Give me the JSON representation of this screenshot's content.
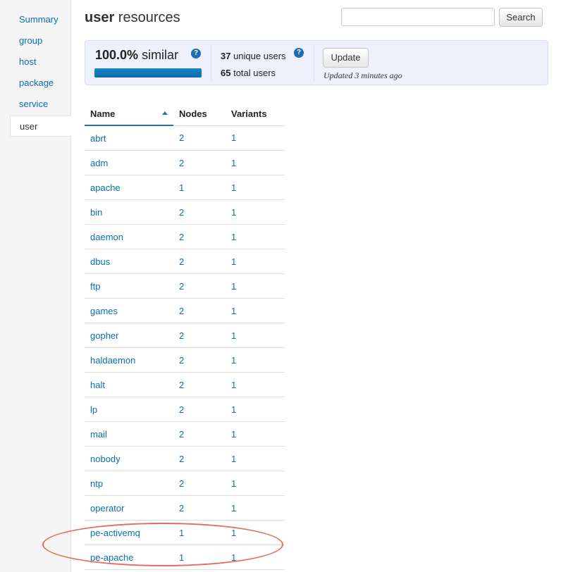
{
  "sidebar": {
    "items": [
      {
        "label": "Summary"
      },
      {
        "label": "group"
      },
      {
        "label": "host"
      },
      {
        "label": "package"
      },
      {
        "label": "service"
      },
      {
        "label": "user",
        "active": true
      }
    ]
  },
  "header": {
    "title_bold": "user",
    "title_rest": " resources"
  },
  "search": {
    "value": "",
    "button_label": "Search"
  },
  "stats": {
    "similarity_value": "100.0%",
    "similarity_label": " similar",
    "similarity_fraction": 1.0,
    "help_glyph": "?",
    "unique_users_count": "37",
    "unique_users_label": " unique users",
    "total_users_count": "65",
    "total_users_label": " total users",
    "update_button_label": "Update",
    "updated_note": "Updated 3 minutes ago"
  },
  "table": {
    "headers": [
      "Name",
      "Nodes",
      "Variants"
    ],
    "sort": {
      "column": "Name",
      "direction": "ascending"
    },
    "rows": [
      {
        "name": "abrt",
        "nodes": "2",
        "variants": "1"
      },
      {
        "name": "adm",
        "nodes": "2",
        "variants": "1"
      },
      {
        "name": "apache",
        "nodes": "1",
        "variants": "1"
      },
      {
        "name": "bin",
        "nodes": "2",
        "variants": "1"
      },
      {
        "name": "daemon",
        "nodes": "2",
        "variants": "1"
      },
      {
        "name": "dbus",
        "nodes": "2",
        "variants": "1"
      },
      {
        "name": "ftp",
        "nodes": "2",
        "variants": "1"
      },
      {
        "name": "games",
        "nodes": "2",
        "variants": "1"
      },
      {
        "name": "gopher",
        "nodes": "2",
        "variants": "1"
      },
      {
        "name": "haldaemon",
        "nodes": "2",
        "variants": "1"
      },
      {
        "name": "halt",
        "nodes": "2",
        "variants": "1"
      },
      {
        "name": "lp",
        "nodes": "2",
        "variants": "1"
      },
      {
        "name": "mail",
        "nodes": "2",
        "variants": "1"
      },
      {
        "name": "nobody",
        "nodes": "2",
        "variants": "1"
      },
      {
        "name": "ntp",
        "nodes": "2",
        "variants": "1"
      },
      {
        "name": "operator",
        "nodes": "2",
        "variants": "1"
      },
      {
        "name": "pe-activemq",
        "nodes": "1",
        "variants": "1"
      },
      {
        "name": "pe-apache",
        "nodes": "1",
        "variants": "1"
      }
    ]
  },
  "colors": {
    "link": "#0a6fb4",
    "accent": "#1f74b4",
    "stats_background": "#eef1fb",
    "annotation": "#e46d5e"
  }
}
